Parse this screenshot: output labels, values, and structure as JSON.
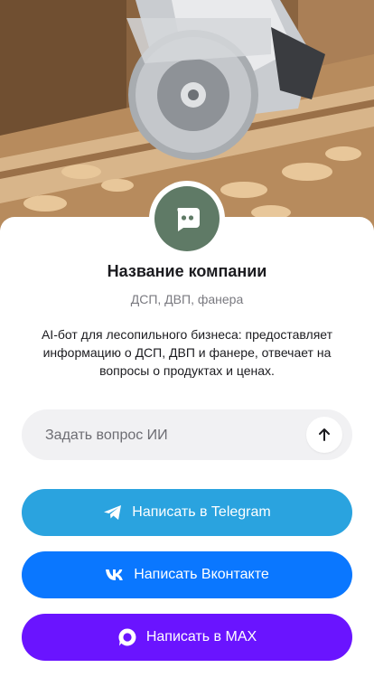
{
  "hero": {
    "image": "circular-saw-cutting-wood-photo"
  },
  "company": {
    "name": "Название компании",
    "tags": "ДСП, ДВП, фанера",
    "description": "AI-бот для лесопильного бизнеса: предоставляет информацию о ДСП, ДВП и фанере, отвечает на вопросы о продуктах и ценах.",
    "avatar_icon": "chat-bot-icon",
    "avatar_color": "#5f7a66"
  },
  "ask": {
    "placeholder": "Задать вопрос ИИ",
    "value": "",
    "send_icon": "arrow-up-icon"
  },
  "buttons": {
    "telegram": {
      "label": "Написать в Telegram",
      "icon": "telegram-icon",
      "color": "#2aa3df"
    },
    "vk": {
      "label": "Написать Вконтакте",
      "icon": "vk-icon",
      "color": "#0a77ff"
    },
    "max": {
      "label": "Написать в MAX",
      "icon": "max-icon",
      "color": "#6a14ff"
    }
  }
}
